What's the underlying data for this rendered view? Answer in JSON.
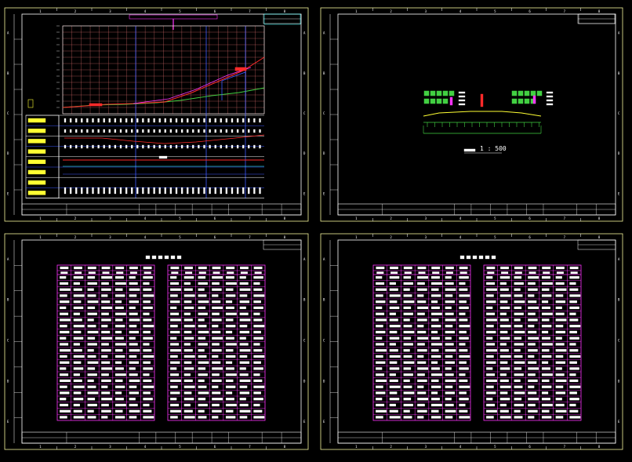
{
  "colors": {
    "background": "#000000",
    "frame": "#f5f59a",
    "line": "#ffffff",
    "grid": "#d46a6a",
    "magenta": "#ff33ff",
    "blue": "#3e5bff",
    "red": "#ff2a2a",
    "green": "#42d042",
    "yellow": "#ffff33",
    "cyan": "#33ffff",
    "table_border": "#ff33ff"
  },
  "sheets": {
    "tl": {
      "kind": "profile",
      "border_numbers": [
        "1",
        "2",
        "3",
        "4",
        "5",
        "6",
        "7",
        "8"
      ],
      "side_letters": [
        "A",
        "B",
        "C",
        "D",
        "E"
      ]
    },
    "tr": {
      "kind": "cross-section",
      "border_numbers": [
        "1",
        "2",
        "3",
        "4",
        "5",
        "6",
        "7",
        "8"
      ],
      "side_letters": [
        "A",
        "B",
        "C",
        "D",
        "E"
      ]
    },
    "bl": {
      "kind": "table",
      "border_numbers": [
        "1",
        "2",
        "3",
        "4",
        "5",
        "6",
        "7",
        "8"
      ],
      "side_letters": [
        "A",
        "B",
        "C",
        "D",
        "E"
      ]
    },
    "br": {
      "kind": "table",
      "border_numbers": [
        "1",
        "2",
        "3",
        "4",
        "5",
        "6",
        "7",
        "8"
      ],
      "side_letters": [
        "A",
        "B",
        "C",
        "D",
        "E"
      ]
    }
  },
  "cross_section": {
    "scale_label": "1 : 500"
  }
}
